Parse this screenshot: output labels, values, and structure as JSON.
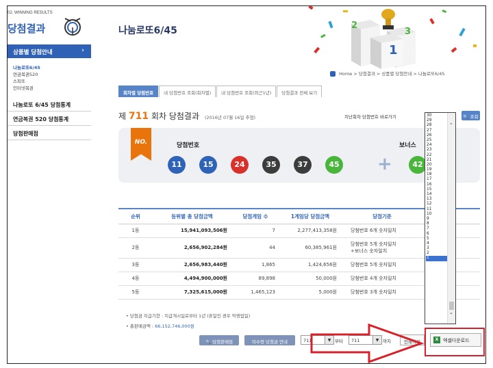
{
  "sidebar": {
    "eng_title": "02. WINNING RESULTS",
    "title": "당첨결과",
    "active_menu": "상품별 당첨안내",
    "active_arrow": "›",
    "sub_items": [
      "나눔로또6/45",
      "연금복권520",
      "스피또",
      "인터넷복권"
    ],
    "menu_items": [
      "나눔로또 6/45 당첨통계",
      "연금복권 520 당첨통계",
      "당첨판매점"
    ]
  },
  "header": {
    "title": "나눔로또6/45",
    "podium_numbers": [
      "2",
      "3",
      "1"
    ]
  },
  "breadcrumb": [
    "Home",
    "당첨결과",
    "상품별 당첨안내",
    "나눔로또6/45"
  ],
  "breadcrumb_sep": ">",
  "tabs": [
    "회차별 당첨번호",
    "내 당첨번호 조회(회차별)",
    "내 당첨번호 조회(최근1년)",
    "당첨결과 전체 보기"
  ],
  "round": {
    "prefix": "제",
    "number": "711",
    "suffix": "회차 당첨결과",
    "date": "(2016년 07월 16일 추첨)"
  },
  "prev_search_label": "지난회차 당첨번호 바로가기",
  "search_button": "조회",
  "result": {
    "ribbon": "NO.",
    "win_label": "당첨번호",
    "bonus_label": "보너스",
    "plus": "+",
    "balls": [
      {
        "num": "11",
        "color": "#2f63b8"
      },
      {
        "num": "15",
        "color": "#2f63b8"
      },
      {
        "num": "24",
        "color": "#d8302a"
      },
      {
        "num": "35",
        "color": "#3c3c3c"
      },
      {
        "num": "37",
        "color": "#3c3c3c"
      },
      {
        "num": "45",
        "color": "#49b53a"
      }
    ],
    "bonus_ball": {
      "num": "42",
      "color": "#49b53a"
    }
  },
  "table": {
    "headers": [
      "순위",
      "등위별 총 당첨금액",
      "당첨게임 수",
      "1게임당 당첨금액",
      "당첨기준",
      "비고"
    ],
    "rows": [
      {
        "rank": "1등",
        "total": "15,941,093,506원",
        "count": "7",
        "per": "2,277,413,358원",
        "criteria": "당첨번호 6개 숫자일치",
        "criteria2": ""
      },
      {
        "rank": "2등",
        "total": "2,656,902,284원",
        "count": "44",
        "per": "60,385,961원",
        "criteria": "당첨번호 5개 숫자일치",
        "criteria2": "+보너스 숫자일치"
      },
      {
        "rank": "3등",
        "total": "2,656,983,440원",
        "count": "1,865",
        "per": "1,424,656원",
        "criteria": "당첨번호 5개 숫자일치",
        "criteria2": ""
      },
      {
        "rank": "4등",
        "total": "4,494,900,000원",
        "count": "89,898",
        "per": "50,000원",
        "criteria": "당첨번호 4개 숫자일치",
        "criteria2": ""
      },
      {
        "rank": "5등",
        "total": "7,325,615,000원",
        "count": "1,465,123",
        "per": "5,000원",
        "criteria": "당첨번호 3개 숫자일치",
        "criteria2": ""
      }
    ]
  },
  "notes": {
    "note1": "당첨금 지급기한 : 지급개시일로부터 1년 (휴일인 경우 익영업일)",
    "note2_label": "총판매금액 : ",
    "note2_value": "66,152,746,000원"
  },
  "bottom": {
    "store_button": "당첨판매점",
    "unclaimed_button": "미수령 당첨금 안내",
    "from_value": "711",
    "from_label": "부터",
    "to_value": "711",
    "to_label": "까지",
    "print_button": "인쇄하기",
    "excel_button": "엑셀다운로드",
    "select_arrow": "▼"
  },
  "dropdown": {
    "options": [
      "30",
      "29",
      "28",
      "27",
      "26",
      "25",
      "24",
      "23",
      "22",
      "21",
      "20",
      "19",
      "18",
      "17",
      "16",
      "15",
      "14",
      "13",
      "12",
      "11",
      "10",
      "9",
      "8",
      "7",
      "6",
      "5",
      "4",
      "3",
      "2",
      "1"
    ],
    "highlighted": "1",
    "up_arrow": "⌃",
    "down_arrow": "⌄"
  },
  "colors": {
    "accent": "#2f62b7",
    "orange": "#e9740c",
    "annotation_red": "#d8202a"
  }
}
